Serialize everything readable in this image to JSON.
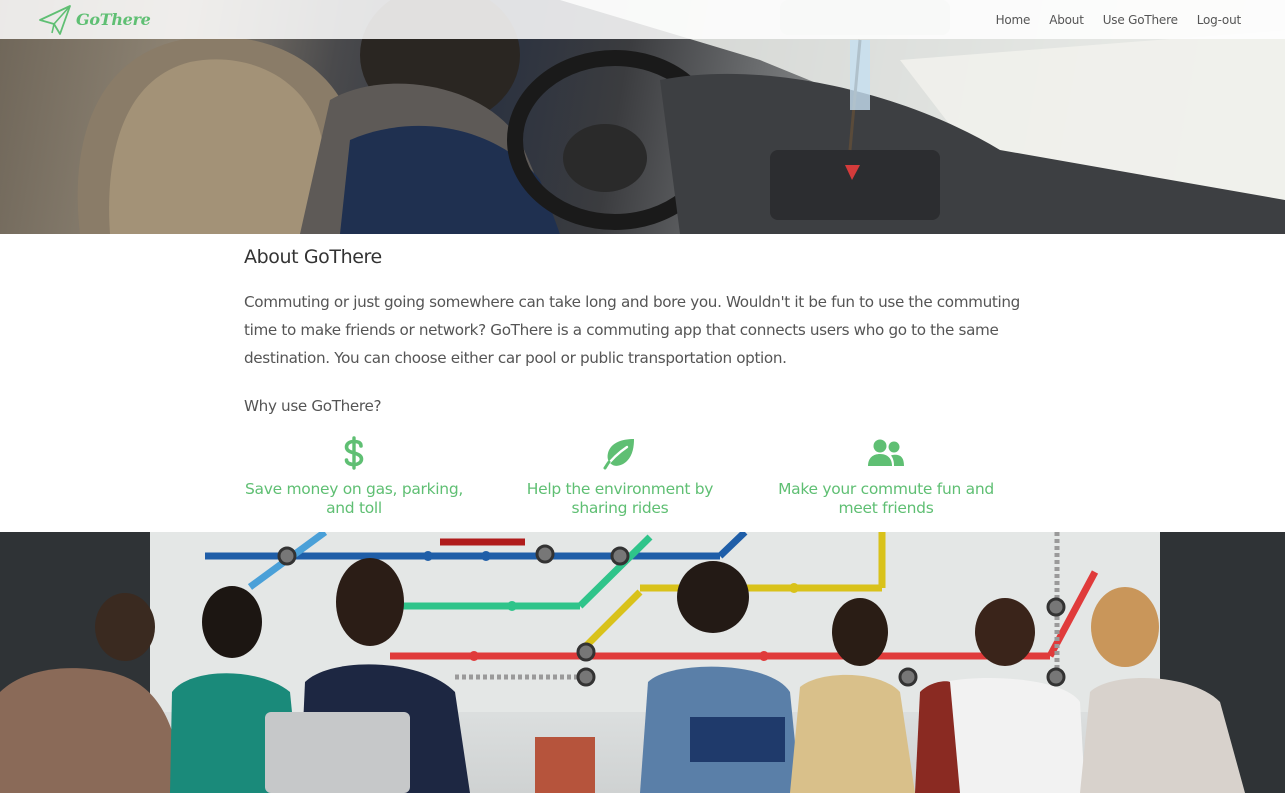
{
  "nav": {
    "brand": "GoThere",
    "links": [
      "Home",
      "About",
      "Use GoThere",
      "Log-out"
    ]
  },
  "about": {
    "title": "About GoThere",
    "paragraph": "Commuting or just going somewhere can take long and bore you. Wouldn't it be fun to use the commuting time to make friends or network? GoThere is a commuting app that connects users who go to the same destination. You can choose either car pool or public transportation option.",
    "why": "Why use GoThere?"
  },
  "features": [
    {
      "icon": "dollar-icon",
      "text": "Save money on gas, parking, and toll"
    },
    {
      "icon": "leaf-icon",
      "text": "Help the environment by sharing rides"
    },
    {
      "icon": "users-icon",
      "text": "Make your commute fun and meet friends"
    }
  ],
  "colors": {
    "accent": "#5fbf73",
    "text": "#555555"
  }
}
